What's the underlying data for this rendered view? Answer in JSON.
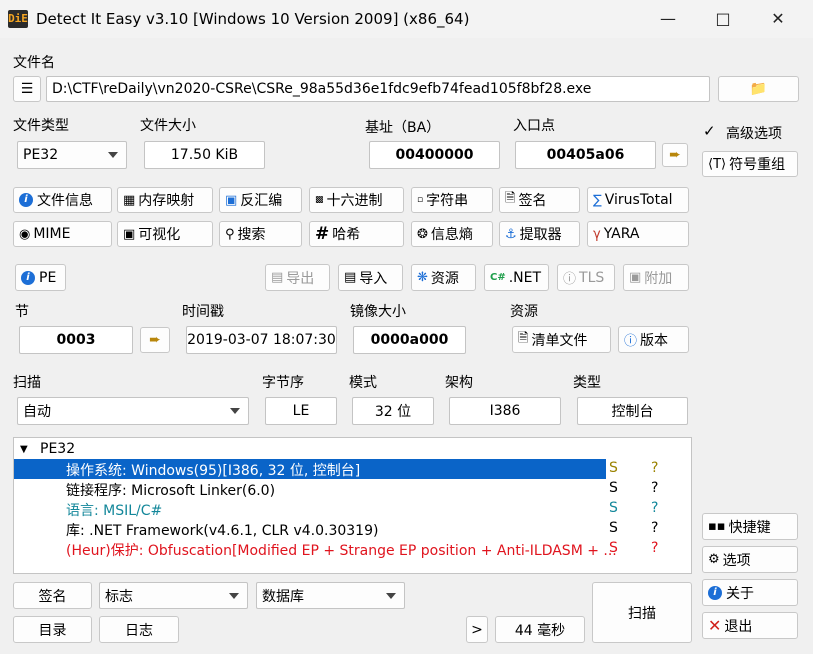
{
  "window": {
    "title": "Detect It Easy v3.10 [Windows 10 Version 2009] (x86_64)",
    "icon_text": "DiE"
  },
  "file": {
    "label": "文件名",
    "path": "D:\\CTF\\reDaily\\vn2020-CSRe\\CSRe_98a55d36e1fdc9efb74fead105f8bf28.exe"
  },
  "info": {
    "file_type_label": "文件类型",
    "file_type": "PE32",
    "file_size_label": "文件大小",
    "file_size": "17.50 KiB",
    "base_label": "基址（BA）",
    "base": "00400000",
    "entry_label": "入口点",
    "entry": "00405a06"
  },
  "options": {
    "advanced_label": "高级选项",
    "advanced_checked": "✓",
    "symbol_label": "符号重组"
  },
  "tools_row1": [
    "文件信息",
    "内存映射",
    "反汇编",
    "十六进制",
    "字符串",
    "签名",
    "VirusTotal"
  ],
  "tools_row2": [
    "MIME",
    "可视化",
    "搜索",
    "哈希",
    "信息熵",
    "提取器",
    "YARA"
  ],
  "pe_row": {
    "pe": "PE",
    "export": "导出",
    "import": "导入",
    "resource": "资源",
    "net": ".NET",
    "tls": "TLS",
    "overlay": "附加"
  },
  "pe_info": {
    "section_label": "节",
    "section": "0003",
    "timestamp_label": "时间戳",
    "timestamp": "2019-03-07 18:07:30",
    "image_size_label": "镜像大小",
    "image_size": "0000a000",
    "resource_label": "资源",
    "manifest_btn": "清单文件",
    "version_btn": "版本"
  },
  "scan": {
    "scan_label": "扫描",
    "scan_mode": "自动",
    "endian_label": "字节序",
    "endian": "LE",
    "mode_label": "模式",
    "mode": "32 位",
    "arch_label": "架构",
    "arch": "I386",
    "type_label": "类型",
    "type": "控制台"
  },
  "results": {
    "root": "PE32",
    "rows": [
      {
        "text": "操作系统: Windows(95)[I386, 32 位, 控制台]",
        "s": "S",
        "q": "?"
      },
      {
        "text": "链接程序: Microsoft Linker(6.0)",
        "s": "S",
        "q": "?"
      },
      {
        "text": "语言: MSIL/C#",
        "s": "S",
        "q": "?"
      },
      {
        "text": "库: .NET Framework(v4.6.1, CLR v4.0.30319)",
        "s": "S",
        "q": "?"
      },
      {
        "text": "(Heur)保护: Obfuscation[Modified EP + Strange EP position + Anti-ILDASM + ...",
        "s": "S",
        "q": "?"
      }
    ]
  },
  "side": {
    "shortcuts": "快捷键",
    "options": "选项",
    "about": "关于",
    "exit": "退出"
  },
  "bottom": {
    "signature": "签名",
    "flags": "标志",
    "database": "数据库",
    "directory": "目录",
    "log": "日志",
    "more": ">",
    "elapsed": "44 毫秒",
    "scan": "扫描"
  },
  "colors": {
    "selection": "#0a64c8",
    "yellow_text": "#9a8200",
    "teal_text": "#13879a",
    "red_text": "#e0141e"
  }
}
